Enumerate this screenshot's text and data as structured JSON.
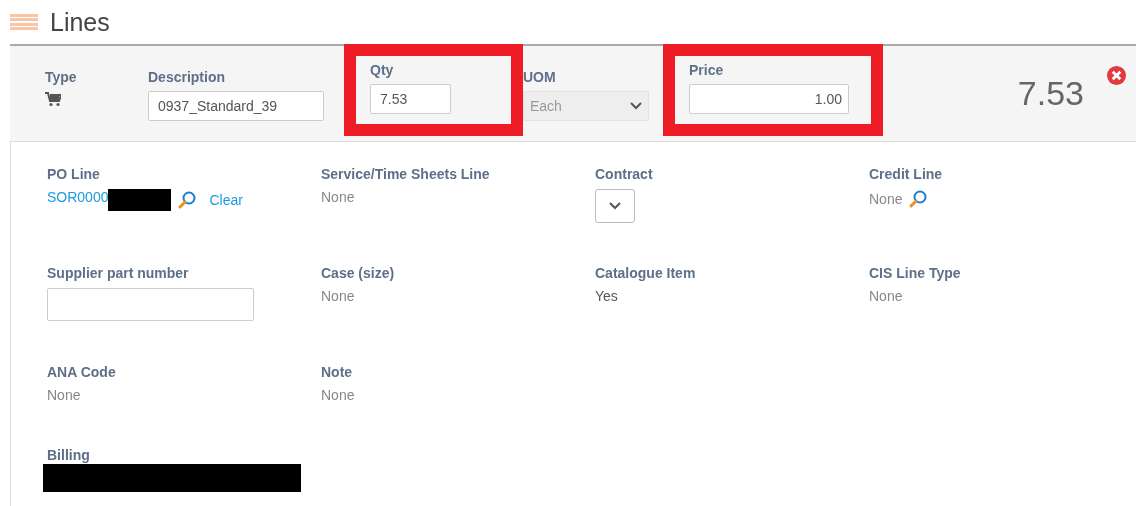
{
  "section": {
    "title": "Lines"
  },
  "header": {
    "fields": [
      {
        "kind": "icon",
        "label": "Type"
      },
      {
        "kind": "input",
        "label": "Description",
        "value": "0937_Standard_39",
        "highlighted": false
      },
      {
        "kind": "input",
        "label": "Qty",
        "value": "7.53",
        "highlighted": true
      },
      {
        "kind": "select",
        "label": "UOM",
        "value": "Each",
        "disabled": true
      },
      {
        "kind": "number",
        "label": "Price",
        "value": "1.00",
        "highlighted": true
      }
    ],
    "total": "7.53"
  },
  "details": [
    {
      "kind": "link-lookup",
      "label": "PO Line",
      "value": "SOR0000",
      "redacted": true,
      "action": "Clear"
    },
    {
      "kind": "text",
      "label": "Service/Time Sheets Line",
      "value": "None"
    },
    {
      "kind": "select",
      "label": "Contract"
    },
    {
      "kind": "lookup",
      "label": "Credit Line",
      "value": "None"
    },
    {
      "kind": "input",
      "label": "Supplier part number"
    },
    {
      "kind": "text",
      "label": "Case (size)",
      "value": "None"
    },
    {
      "kind": "text",
      "label": "Catalogue Item",
      "value": "Yes"
    },
    {
      "kind": "text",
      "label": "CIS Line Type",
      "value": "None"
    },
    {
      "kind": "text",
      "label": "ANA Code",
      "value": "None"
    },
    {
      "kind": "text",
      "label": "Note",
      "value": "None"
    },
    {
      "kind": "blank"
    },
    {
      "kind": "blank"
    },
    {
      "kind": "redacted",
      "label": "Billing",
      "redacted": true
    }
  ]
}
